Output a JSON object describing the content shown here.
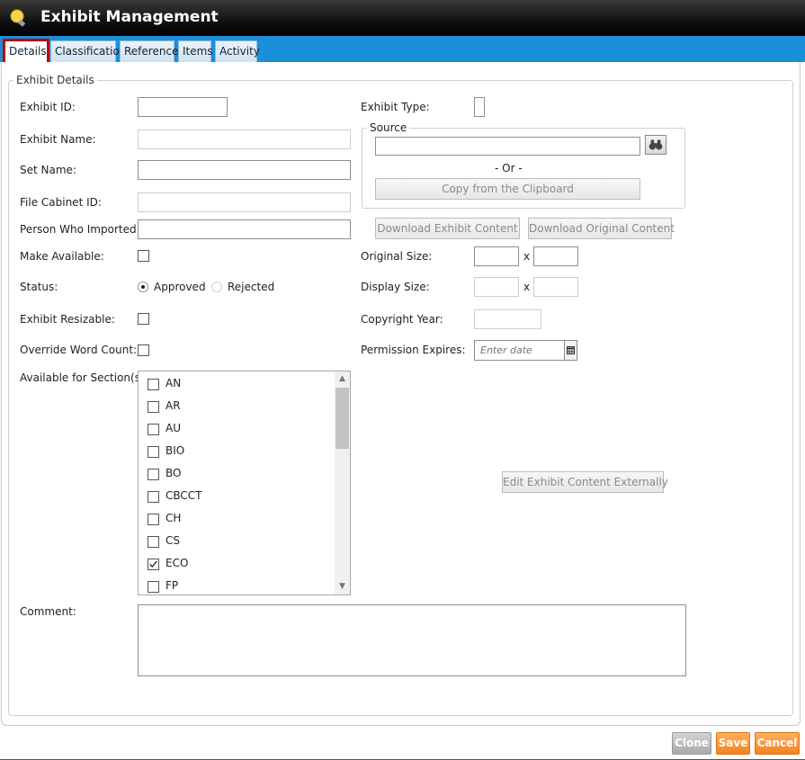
{
  "window": {
    "title": "Exhibit Management",
    "logo_icon": "lightbulb-icon"
  },
  "tabs": [
    {
      "label": "Details",
      "active": true
    },
    {
      "label": "Classification",
      "active": false
    },
    {
      "label": "Reference",
      "active": false
    },
    {
      "label": "Items",
      "active": false
    },
    {
      "label": "Activity",
      "active": false
    }
  ],
  "details": {
    "legend": "Exhibit Details",
    "left_labels": {
      "exhibit_id": "Exhibit ID:",
      "exhibit_name": "Exhibit Name:",
      "set_name": "Set Name:",
      "file_cabinet_id": "File Cabinet ID:",
      "person_imported": "Person Who Imported:",
      "make_available": "Make Available:",
      "status": "Status:",
      "exhibit_resizable": "Exhibit Resizable:",
      "override_word_count": "Override Word Count:",
      "available_sections": "Available for Section(s)",
      "comment": "Comment:"
    },
    "status_options": {
      "approved": "Approved",
      "rejected": "Rejected",
      "selected": "Approved"
    },
    "right_labels": {
      "exhibit_type": "Exhibit Type:",
      "original_size": "Original Size:",
      "display_size": "Display Size:",
      "copyright_year": "Copyright Year:",
      "permission_expires": "Permission Expires:",
      "size_sep": "x"
    },
    "source": {
      "legend": "Source",
      "or_text": "- Or -",
      "copy_clipboard": "Copy from the Clipboard",
      "browse_icon": "binoculars-icon"
    },
    "buttons": {
      "download_exhibit": "Download Exhibit Content",
      "download_original": "Download Original Content",
      "edit_external": "Edit Exhibit Content Externally"
    },
    "permission_placeholder": "Enter date",
    "sections": [
      {
        "label": "AN",
        "checked": false
      },
      {
        "label": "AR",
        "checked": false
      },
      {
        "label": "AU",
        "checked": false
      },
      {
        "label": "BIO",
        "checked": false
      },
      {
        "label": "BO",
        "checked": false
      },
      {
        "label": "CBCCT",
        "checked": false
      },
      {
        "label": "CH",
        "checked": false
      },
      {
        "label": "CS",
        "checked": false
      },
      {
        "label": "ECO",
        "checked": true
      },
      {
        "label": "FP",
        "checked": false
      }
    ]
  },
  "footer": {
    "clone": "Clone",
    "save": "Save",
    "cancel": "Cancel"
  },
  "colors": {
    "tabbar": "#1b8fd8",
    "accent_orange": "#f5821f",
    "active_tab_border": "#b00000"
  }
}
